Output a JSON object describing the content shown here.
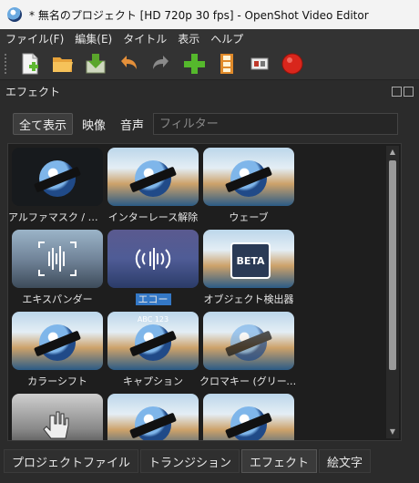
{
  "window": {
    "title": "* 無名のプロジェクト [HD 720p 30 fps] - OpenShot Video Editor"
  },
  "menu": [
    "ファイル(F)",
    "編集(E)",
    "タイトル",
    "表示",
    "ヘルプ"
  ],
  "toolbar": {
    "icons": [
      "new-project-icon",
      "open-project-icon",
      "save-project-icon",
      "undo-icon",
      "redo-icon",
      "add-track-icon",
      "add-marker-icon",
      "export-video-icon",
      "record-icon"
    ]
  },
  "dock": {
    "title": "エフェクト",
    "filters": [
      "全て表示",
      "映像",
      "音声"
    ],
    "active_filter": "全て表示",
    "search_placeholder": "フィルター"
  },
  "effects": [
    {
      "label": "アルファマスク / ワ…",
      "thumb": "dark",
      "selected": false
    },
    {
      "label": "インターレース解除",
      "thumb": "sky",
      "selected": false
    },
    {
      "label": "ウェーブ",
      "thumb": "sky",
      "selected": false
    },
    {
      "label": "エキスパンダー",
      "thumb": "wavebg",
      "selected": false
    },
    {
      "label": "エコー",
      "thumb": "purple",
      "selected": true
    },
    {
      "label": "オブジェクト検出器",
      "thumb": "sky",
      "selected": false
    },
    {
      "label": "カラーシフト",
      "thumb": "sky",
      "selected": false
    },
    {
      "label": "キャプション",
      "thumb": "sky",
      "selected": false
    },
    {
      "label": "クロマキー (グリーン…",
      "thumb": "sky",
      "selected": false
    },
    {
      "label": "",
      "thumb": "grey",
      "selected": false
    },
    {
      "label": "",
      "thumb": "sky",
      "selected": false
    },
    {
      "label": "",
      "thumb": "sky",
      "selected": false
    }
  ],
  "thumb_texts": {
    "beta": "BETA",
    "abc": "ABC 123"
  },
  "tabs": [
    "プロジェクトファイル",
    "トランジション",
    "エフェクト",
    "絵文字"
  ],
  "active_tab": "エフェクト",
  "colors": {
    "accent": "#3478c6",
    "record": "#d9261c",
    "green": "#55b82c"
  }
}
